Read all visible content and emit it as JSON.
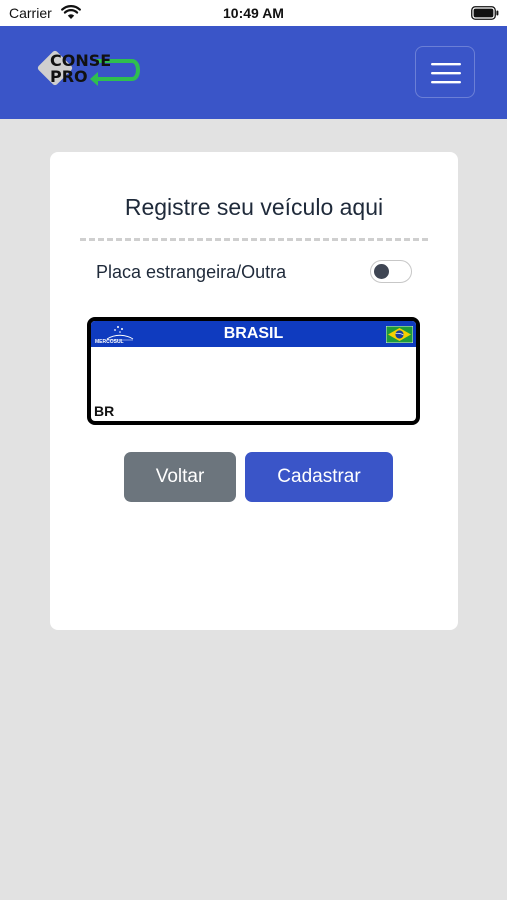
{
  "status_bar": {
    "carrier": "Carrier",
    "time": "10:49 AM",
    "icons": [
      "wifi-icon",
      "battery-icon"
    ]
  },
  "header": {
    "background_color": "#3a55c8",
    "logo": {
      "line1": "CONSE",
      "line2": "PRO",
      "arrow_color": "#2fbf4f"
    },
    "menu_icon": "hamburger-menu-icon"
  },
  "card": {
    "title": "Registre seu veículo aqui",
    "toggle": {
      "label": "Placa estrangeira/Outra",
      "checked": false
    },
    "plate": {
      "country": "BRASIL",
      "union_label": "MERCOSUL",
      "country_code": "BR",
      "band_color": "#0f3bbf",
      "value": ""
    },
    "buttons": {
      "back_label": "Voltar",
      "submit_label": "Cadastrar",
      "back_color": "#6c757d",
      "submit_color": "#3a55c8"
    }
  }
}
